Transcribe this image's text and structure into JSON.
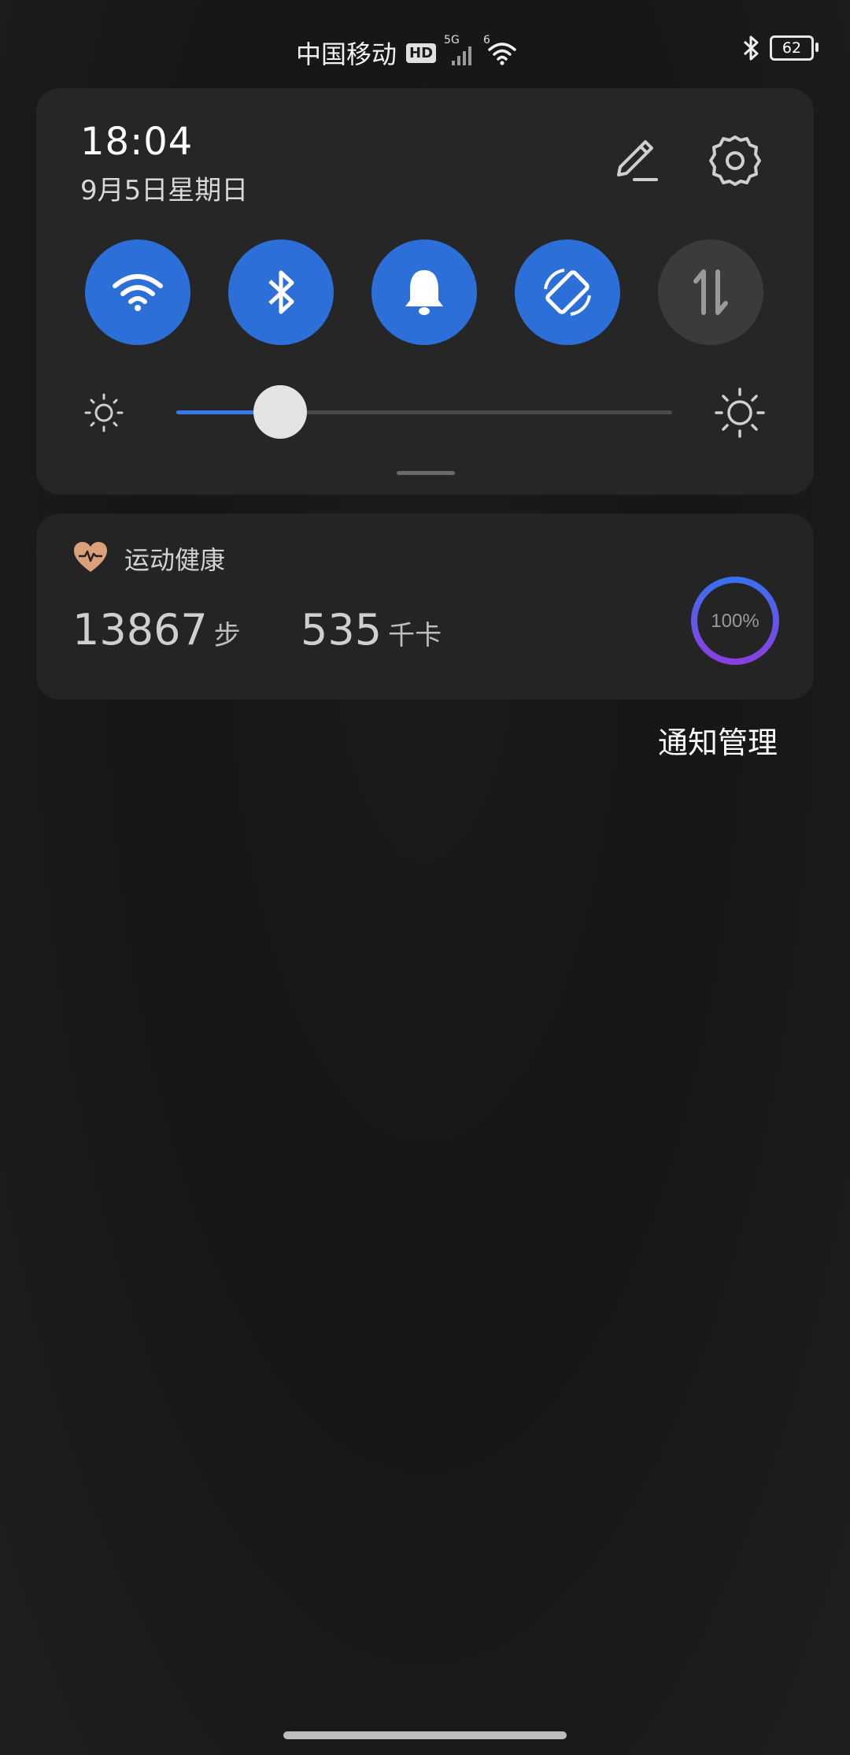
{
  "status_bar": {
    "carrier": "中国移动",
    "hd": "HD",
    "network_5g": "5G",
    "wifi_tag": "6",
    "battery": "62"
  },
  "panel": {
    "time": "18:04",
    "date": "9月5日星期日",
    "toggles": [
      {
        "name": "wifi",
        "state": "on"
      },
      {
        "name": "bluetooth",
        "state": "on"
      },
      {
        "name": "sound",
        "state": "on"
      },
      {
        "name": "auto-rotate",
        "state": "on"
      },
      {
        "name": "mobile-data",
        "state": "off"
      }
    ],
    "brightness_level": 0.21
  },
  "health": {
    "title": "运动健康",
    "steps_value": "13867",
    "steps_unit": "步",
    "kcal_value": "535",
    "kcal_unit": "千卡",
    "goal_percent": "100%"
  },
  "notification_management": "通知管理",
  "colors": {
    "accent": "#2d6fd8",
    "panel_bg": "#262626",
    "ring_start": "#3a6ff0",
    "ring_end": "#8a3fe0",
    "health_icon": "#d9a07a"
  }
}
